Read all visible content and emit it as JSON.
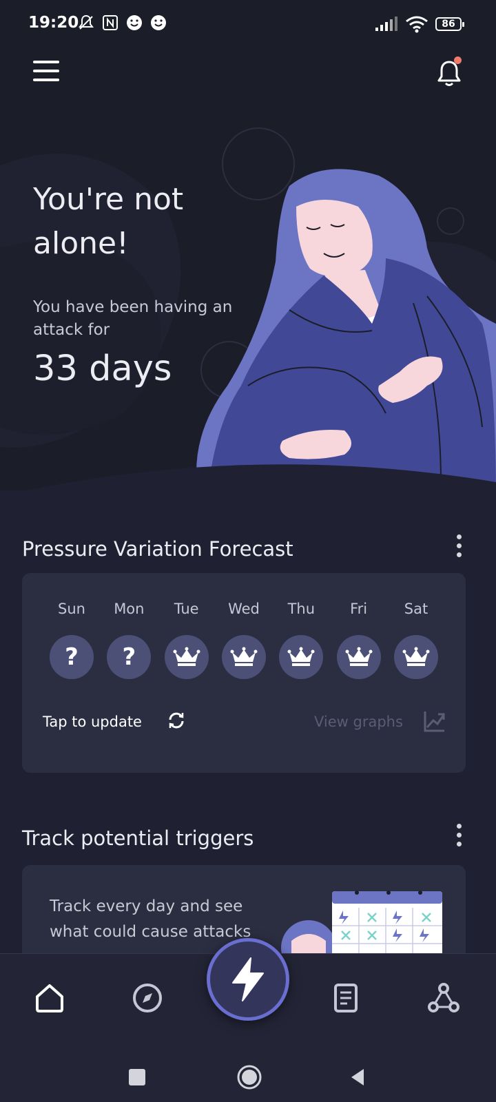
{
  "status_bar": {
    "time": "19:20",
    "battery": "86"
  },
  "hero": {
    "title": "You're not alone!",
    "subtitle": "You have been having an attack for",
    "days": "33 days"
  },
  "forecast": {
    "title": "Pressure Variation Forecast",
    "days": [
      {
        "label": "Sun",
        "value": "?"
      },
      {
        "label": "Mon",
        "value": "?"
      },
      {
        "label": "Tue",
        "value": "crown"
      },
      {
        "label": "Wed",
        "value": "crown"
      },
      {
        "label": "Thu",
        "value": "crown"
      },
      {
        "label": "Fri",
        "value": "crown"
      },
      {
        "label": "Sat",
        "value": "crown"
      }
    ],
    "tap_label": "Tap to update",
    "view_label": "View graphs"
  },
  "triggers": {
    "title": "Track potential triggers",
    "text": "Track every day and see what could cause attacks"
  },
  "nav": {
    "items": [
      "home-icon",
      "compass-icon",
      "lightning-icon",
      "journal-icon",
      "community-icon"
    ],
    "active": "home-icon"
  },
  "colors": {
    "background": "#1b1d29",
    "card": "#2b2e41",
    "accent": "#6a6ed0",
    "notification": "#f07b6d"
  }
}
